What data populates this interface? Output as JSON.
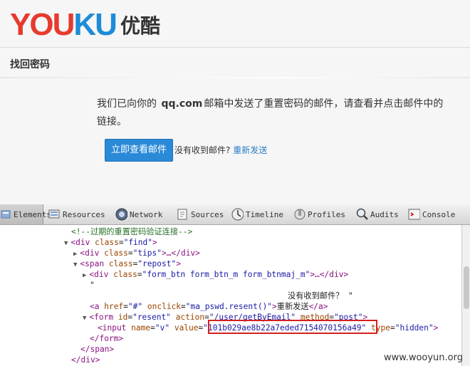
{
  "logo": {
    "latin_letters": [
      {
        "ch": "Y",
        "color": "#e63a2e"
      },
      {
        "ch": "O",
        "color": "#e63a2e"
      },
      {
        "ch": "U",
        "color": "#e63a2e"
      },
      {
        "ch": "K",
        "color": "#1e8cd8"
      },
      {
        "ch": "U",
        "color": "#1e8cd8"
      }
    ],
    "chinese": "优酷"
  },
  "page": {
    "section_title": "找回密码",
    "message_prefix": "我们已向你的",
    "mail_domain": "qq.com",
    "message_suffix": "邮箱中发送了重置密码的邮件，请查看并点击邮件中的链接。",
    "check_mail_button": "立即查看邮件",
    "not_received_text": "没有收到邮件?",
    "resend_link": "重新发送"
  },
  "devtools": {
    "tabs": [
      {
        "label": "Elements",
        "icon": "elements-icon",
        "active": true
      },
      {
        "label": "Resources",
        "icon": "resources-icon",
        "active": false
      },
      {
        "label": "Network",
        "icon": "network-icon",
        "active": false
      },
      {
        "label": "Sources",
        "icon": "sources-icon",
        "active": false
      },
      {
        "label": "Timeline",
        "icon": "timeline-icon",
        "active": false
      },
      {
        "label": "Profiles",
        "icon": "profiles-icon",
        "active": false
      },
      {
        "label": "Audits",
        "icon": "audits-icon",
        "active": false
      },
      {
        "label": "Console",
        "icon": "console-icon",
        "active": false
      }
    ],
    "code_lines": {
      "comment": "<!--过期的重置密码验证连接-->",
      "div_find_tag": "div",
      "div_find_attr": "class",
      "div_find_val": "\"find\"",
      "div_tips_tag": "div",
      "div_tips_attr": "class",
      "div_tips_val": "\"tips\"",
      "div_tips_rest": "…</div>",
      "span_tag": "span",
      "span_attr": "class",
      "span_val": "\"repost\"",
      "div_formbtn_tag": "div",
      "div_formbtn_attr": "class",
      "div_formbtn_val": "\"form_btn form_btn_m form_btnmaj_m\"",
      "div_formbtn_rest": "…</div>",
      "quote_line": "\"",
      "anchor_href_attr": "href",
      "anchor_href_val": "\"#\"",
      "anchor_onclick_attr": "onclick",
      "anchor_onclick_val": "\"ma_pswd.resent()\"",
      "anchor_text": "重新发送",
      "anchor_close": "</a>",
      "floating_text": "没有收到邮件？ \"",
      "form_id_attr": "id",
      "form_id_val": "\"resent\"",
      "form_action_attr": "action",
      "form_action_val": "\"/user/getByEmail\"",
      "form_method_attr": "method",
      "form_method_val": "\"post\"",
      "input_name_attr": "name",
      "input_name_val": "\"v\"",
      "input_value_attr": "value",
      "input_value_val": "\"101b029ae8b22a7eded7154070156a49\"",
      "input_type_attr": "type",
      "input_type_val": "\"hidden\"",
      "form_close": "</form>",
      "span_close": "</span>",
      "div_close": "</div>"
    }
  },
  "watermark": "www.wooyun.org"
}
